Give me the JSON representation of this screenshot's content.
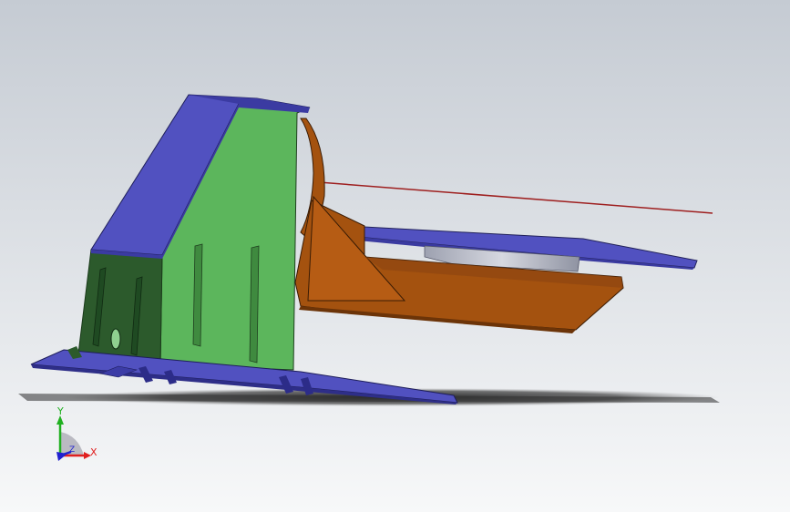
{
  "viewport": {
    "background_top": "#c5cbd3",
    "background_bottom": "#f7f8f9"
  },
  "model": {
    "colors": {
      "green_part": "#5cb65c",
      "green_dark": "#2c5a2c",
      "blue_plate": "#5151c0",
      "blue_light": "#6b6bd4",
      "orange_part": "#a4520f",
      "orange_dark": "#7a3c0a",
      "grey_part": "#b5b8c4",
      "sketch_line": "#9e1f1f",
      "shadow": "#2b2b2b"
    }
  },
  "triad": {
    "x_label": "X",
    "y_label": "Y",
    "z_label": "Z",
    "x_color": "#e02020",
    "y_color": "#20b020",
    "z_color": "#2020d0"
  }
}
